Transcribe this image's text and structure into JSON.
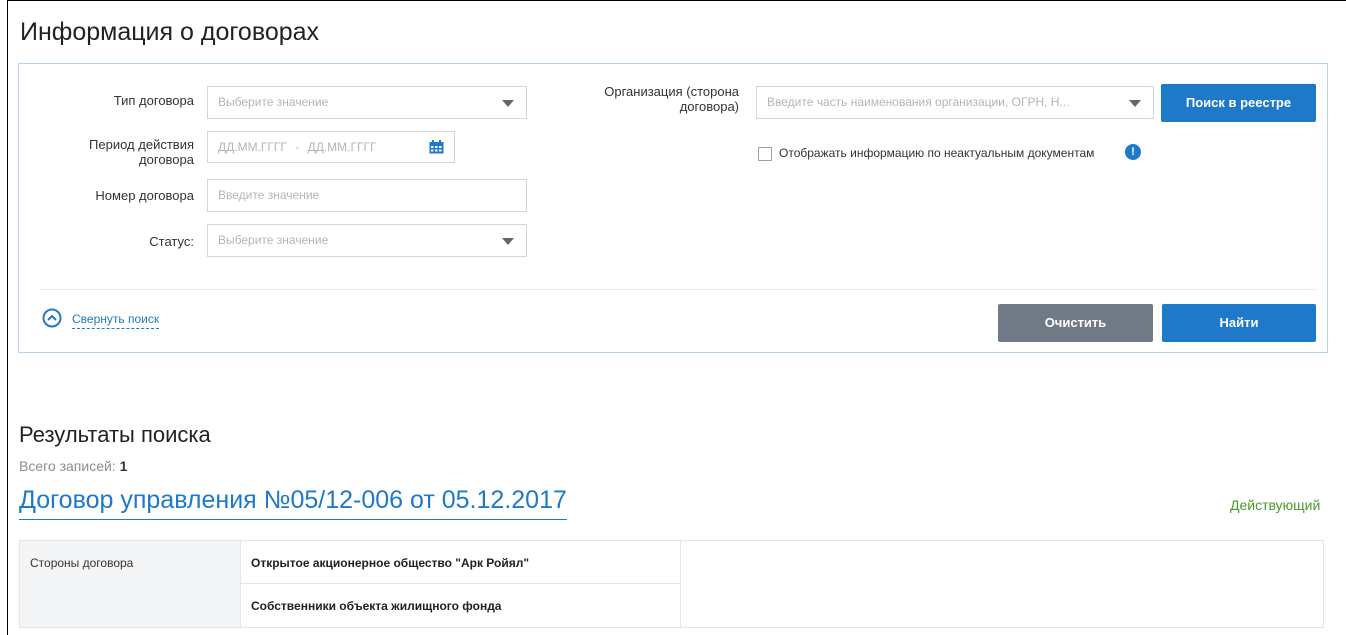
{
  "page_title": "Информация о договорах",
  "search": {
    "type_label": "Тип договора",
    "type_placeholder": "Выберите значение",
    "period_label_line1": "Период действия",
    "period_label_line2": "договора",
    "period_from_placeholder": "ДД.ММ.ГГГГ",
    "period_sep": "-",
    "period_to_placeholder": "ДД.ММ.ГГГГ",
    "number_label": "Номер договора",
    "number_placeholder": "Введите значение",
    "status_label": "Статус:",
    "status_placeholder": "Выберите значение",
    "org_label_line1": "Организация (сторона",
    "org_label_line2": "договора)",
    "org_placeholder": "Введите часть наименования организации, ОГРН, Н...",
    "registry_button": "Поиск в реестре",
    "show_inactive_label": "Отображать информацию по неактуальным документам",
    "show_inactive_checked": false,
    "collapse_link": "Свернуть поиск",
    "clear_button": "Очистить",
    "find_button": "Найти"
  },
  "results": {
    "title": "Результаты поиска",
    "total_label": "Всего записей:",
    "total_value": "1",
    "contract_title": "Договор управления №05/12-006 от 05.12.2017",
    "contract_status": "Действующий",
    "parties_label": "Стороны договора",
    "parties": [
      "Открытое акционерное общество \"Арк Ройял\"",
      "Собственники объекта жилищного фонда"
    ]
  },
  "colors": {
    "accent": "#1e79c8",
    "status_active": "#4a9a2e",
    "button_gray": "#6f7a86"
  },
  "icons": [
    "calendar-icon",
    "chevron-down-icon",
    "info-icon",
    "chevron-up-circle-icon"
  ]
}
